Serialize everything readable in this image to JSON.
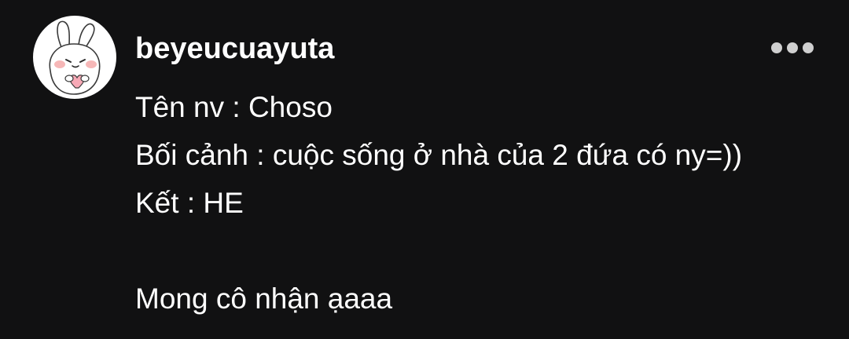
{
  "post": {
    "username": "beyeucuayuta",
    "lines": [
      "Tên nv : Choso",
      "Bối cảnh : cuộc sống ở nhà của 2 đứa có ny=))",
      "Kết : HE",
      "",
      "Mong cô nhận ạaaa"
    ],
    "more_icon": "more-horizontal-icon",
    "avatar_icon": "bunny-avatar-icon"
  },
  "colors": {
    "background": "#111112",
    "text": "#ffffff",
    "menu_dots": "#cfcfcf"
  }
}
